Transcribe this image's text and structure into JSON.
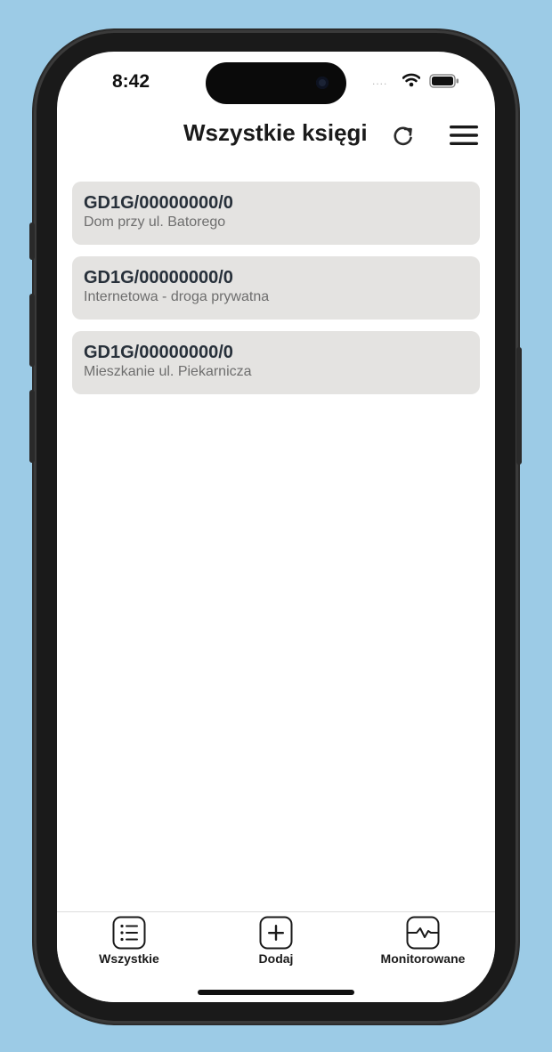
{
  "status_bar": {
    "time": "8:42",
    "signal_dots": "....",
    "wifi_icon": "wifi-icon",
    "battery_icon": "battery-icon"
  },
  "header": {
    "title": "Wszystkie księgi",
    "refresh_icon": "refresh-icon",
    "menu_icon": "hamburger-menu-icon"
  },
  "books": [
    {
      "number": "GD1G/00000000/0",
      "description": "Dom przy ul. Batorego"
    },
    {
      "number": "GD1G/00000000/0",
      "description": "Internetowa - droga prywatna"
    },
    {
      "number": "GD1G/00000000/0",
      "description": "Mieszkanie ul. Piekarnicza"
    }
  ],
  "tabbar": {
    "tabs": [
      {
        "label": "Wszystkie",
        "icon": "list-icon"
      },
      {
        "label": "Dodaj",
        "icon": "plus-icon"
      },
      {
        "label": "Monitorowane",
        "icon": "pulse-monitor-icon"
      }
    ]
  },
  "colors": {
    "background": "#9ccbe6",
    "card": "#e4e3e1",
    "card_title": "#27303a",
    "card_subtitle": "#6e6e6e"
  }
}
